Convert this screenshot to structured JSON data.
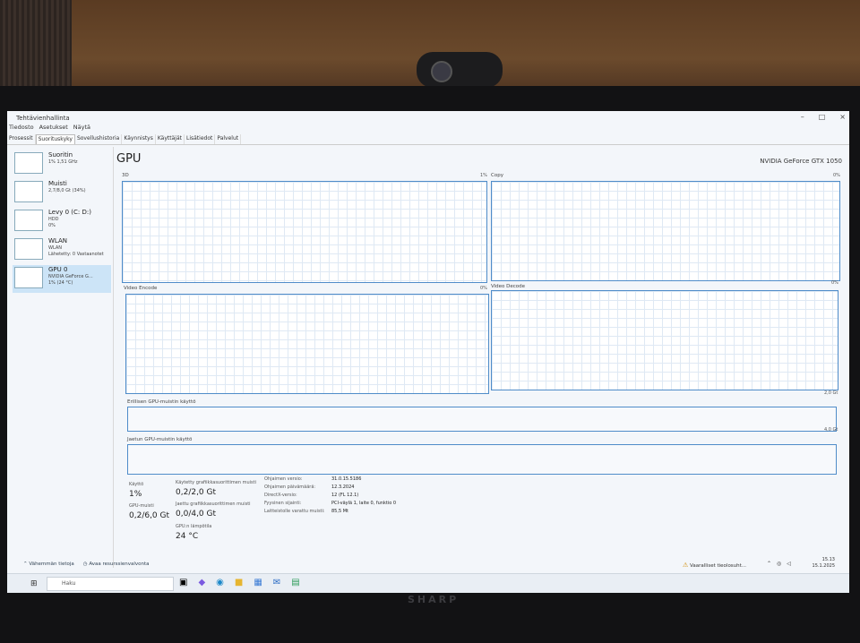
{
  "window": {
    "title": "Tehtävienhallinta",
    "controls": [
      "–",
      "□",
      "×"
    ]
  },
  "menu": [
    "Tiedosto",
    "Asetukset",
    "Näytä"
  ],
  "tabs": [
    "Prosessit",
    "Suorituskyky",
    "Sovellushistoria",
    "Käynnistys",
    "Käyttäjät",
    "Lisätiedot",
    "Palvelut"
  ],
  "sidebar": [
    {
      "name": "Suoritin",
      "sub1": "1% 1,51 GHz",
      "sub2": ""
    },
    {
      "name": "Muisti",
      "sub1": "2,7/8,0 Gt (34%)",
      "sub2": ""
    },
    {
      "name": "Levy 0 (C: D:)",
      "sub1": "HDD",
      "sub2": "0%"
    },
    {
      "name": "WLAN",
      "sub1": "WLAN",
      "sub2": "Lähetetty: 0 Vastaanotet"
    },
    {
      "name": "GPU 0",
      "sub1": "NVIDIA GeForce G...",
      "sub2": "1% (24 °C)"
    }
  ],
  "main": {
    "title": "GPU",
    "model": "NVIDIA GeForce GTX 1050",
    "graphs": [
      {
        "label": "3D",
        "pct": "1%"
      },
      {
        "label": "Copy",
        "pct": "0%"
      },
      {
        "label": "Video Encode",
        "pct": "0%"
      },
      {
        "label": "Video Decode",
        "pct": "0%"
      }
    ],
    "mem_graphs": [
      {
        "label": "Erillisen GPU-muistin käyttö",
        "max": "2,0 Gt"
      },
      {
        "label": "Jaetun GPU-muistin käyttö",
        "max": "4,0 Gt"
      }
    ],
    "stats": {
      "usage_label": "Käyttö",
      "usage_value": "1%",
      "gpu_mem_label": "GPU-muisti",
      "gpu_mem_value": "0,2/6,0 Gt",
      "dedicated_label": "Käytetty grafiikkasuorittimen muisti",
      "dedicated_value": "0,2/2,0 Gt",
      "shared_label": "Jaettu grafiikkasuorittimen muisti",
      "shared_value": "0,0/4,0 Gt",
      "temp_label": "GPU:n lämpötila",
      "temp_value": "24 °C"
    },
    "info": [
      {
        "label": "Ohjaimen versio:",
        "value": "31.0.15.5186"
      },
      {
        "label": "Ohjaimen päivämäärä:",
        "value": "12.3.2024"
      },
      {
        "label": "DirectX-versio:",
        "value": "12 (FL 12.1)"
      },
      {
        "label": "Fyysinen sijainti:",
        "value": "PCI-väylä 1, laite 0, funktio 0"
      },
      {
        "label": "Laitteistolle varattu muisti:",
        "value": "85,5 Mt"
      }
    ]
  },
  "footer": {
    "fewer": "Vähemmän tietoja",
    "resmon": "Avaa resurssienvalvonta"
  },
  "notification": "Vaaralliset tieolosuht...",
  "clock": {
    "time": "15.13",
    "date": "15.1.2025"
  },
  "taskbar": {
    "search_placeholder": "Haku"
  },
  "bezel_brand": "SHARP"
}
